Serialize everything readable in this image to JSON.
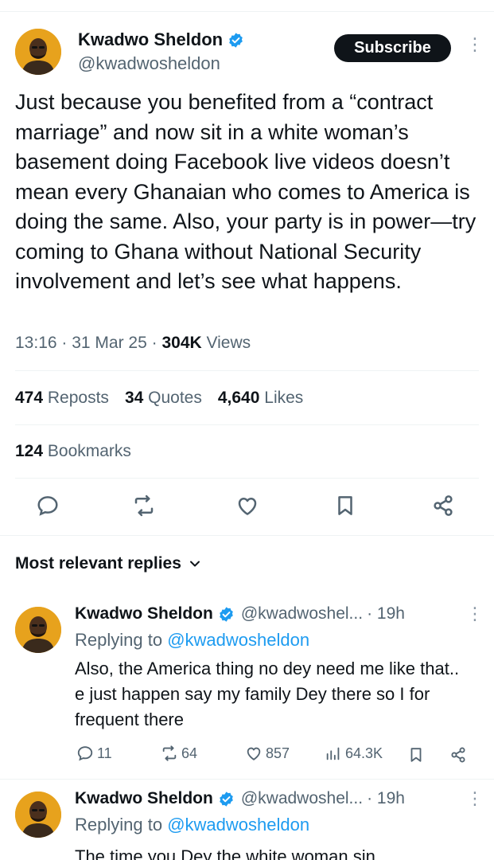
{
  "main_tweet": {
    "author_name": "Kwadwo Sheldon",
    "handle": "@kwadwosheldon",
    "subscribe_label": "Subscribe",
    "text": "Just because you benefited from a “contract marriage” and now sit in a white woman’s basement doing Facebook live videos doesn’t mean every Ghanaian who comes to America is doing the same. Also, your party is in power—try coming to Ghana without National Security involvement and let’s see what happens.",
    "time": "13:16",
    "date": "31 Mar 25",
    "views_count": "304K",
    "views_label": "Views",
    "reposts_count": "474",
    "reposts_label": "Reposts",
    "quotes_count": "34",
    "quotes_label": "Quotes",
    "likes_count": "4,640",
    "likes_label": "Likes",
    "bookmarks_count": "124",
    "bookmarks_label": "Bookmarks"
  },
  "replies_header": "Most relevant replies",
  "replies": [
    {
      "author_name": "Kwadwo Sheldon",
      "handle": "@kwadwoshel...",
      "time": "· 19h",
      "replying_prefix": "Replying to",
      "replying_to": "@kwadwosheldon",
      "text": "Also, the America thing no dey need me like that.. e just happen say my family Dey there so I for frequent there",
      "reply_count": "11",
      "repost_count": "64",
      "like_count": "857",
      "view_count": "64.3K"
    },
    {
      "author_name": "Kwadwo Sheldon",
      "handle": "@kwadwoshel...",
      "time": "· 19h",
      "replying_prefix": "Replying to",
      "replying_to": "@kwadwosheldon",
      "text": "The time you Dey the white woman sin"
    }
  ],
  "colors": {
    "accent_blue": "#1d9bf0",
    "text_primary": "#0f1419",
    "text_secondary": "#536471",
    "divider": "#eff3f4",
    "avatar_bg": "#e7a21d"
  }
}
